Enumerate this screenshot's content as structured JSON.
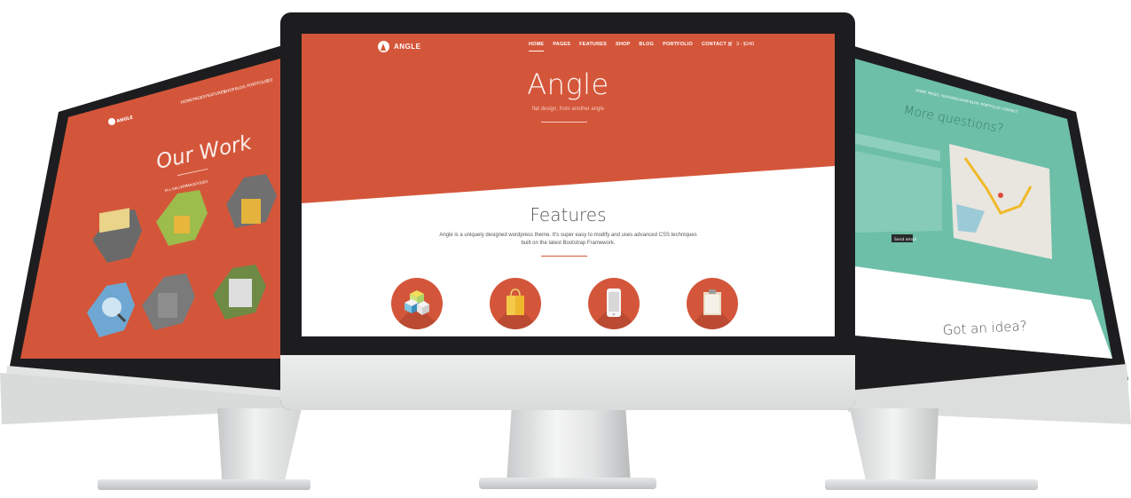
{
  "left_site": {
    "logo_text": "ANGLE",
    "nav": [
      "HOME",
      "PAGES",
      "FEATURES",
      "SHOP",
      "BLOG",
      "PORTFOLIO",
      "CO"
    ],
    "title": "Our Work",
    "filters": [
      "ALL",
      "GALLERY",
      "IMAGE",
      "VIDEO"
    ]
  },
  "center_site": {
    "logo_text": "ANGLE",
    "nav": [
      {
        "label": "HOME",
        "active": true
      },
      {
        "label": "PAGES"
      },
      {
        "label": "FEATURES"
      },
      {
        "label": "SHOP"
      },
      {
        "label": "BLOG"
      },
      {
        "label": "PORTFOLIO"
      },
      {
        "label": "CONTACT"
      }
    ],
    "cart": "3 - $240",
    "hero_title": "Angle",
    "hero_subtitle": "flat design, from another angle",
    "features_title": "Features",
    "features_text": "Angle is a uniquely designed wordpress theme. It's super easy to modify and uses advanced CSS techniques built on the latest Bootstrap Framework.",
    "feature_icons": [
      "cubes-icon",
      "shopping-bag-icon",
      "smartphone-icon",
      "clipboard-icon"
    ]
  },
  "right_site": {
    "nav": [
      "HOME",
      "PAGES",
      "FEATURES",
      "SHOP",
      "BLOG",
      "PORTFOLIO",
      "CONTACT"
    ],
    "title": "More questions?",
    "send_button": "Send email",
    "bottom_title": "Got an idea?"
  },
  "colors": {
    "brand": "#d4563a",
    "teal": "#6dbfa7",
    "bezel": "#1d1d1f",
    "aluminum": "#e3e5e5"
  }
}
